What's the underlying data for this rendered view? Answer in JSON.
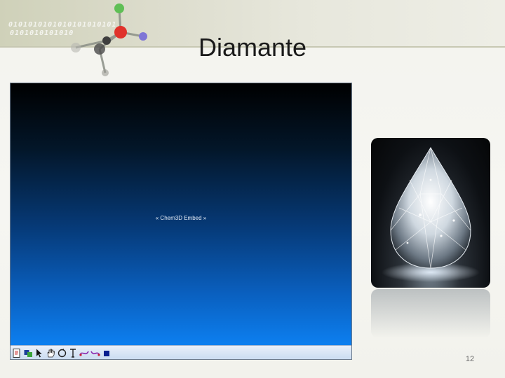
{
  "slide": {
    "title": "Diamante",
    "number": "12",
    "decor": {
      "binary_line_1": "0101010101010101010101",
      "binary_line_2": "0101010101010"
    }
  },
  "embed": {
    "label": "« Chem3D Embed »",
    "toolbar": {
      "items": [
        {
          "name": "document-icon"
        },
        {
          "name": "atom-tool-icon"
        },
        {
          "name": "select-arrow-icon"
        },
        {
          "name": "hand-icon"
        },
        {
          "name": "rotate-icon"
        },
        {
          "name": "text-tool-icon"
        },
        {
          "name": "bond-tool-icon"
        },
        {
          "name": "bond-tool-2-icon"
        },
        {
          "name": "stop-icon"
        }
      ]
    }
  },
  "image": {
    "name": "diamond-photo"
  },
  "colors": {
    "viewer_top": "#000000",
    "viewer_bottom": "#0c7ff0",
    "title_text": "#1a1a1a"
  }
}
